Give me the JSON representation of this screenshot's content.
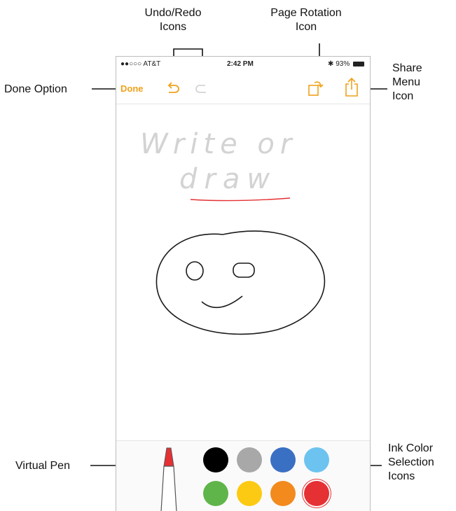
{
  "callouts": {
    "undo_redo": "Undo/Redo\nIcons",
    "page_rotation": "Page Rotation\nIcon",
    "done_option": "Done Option",
    "share_menu": "Share\nMenu\nIcon",
    "virtual_pen": "Virtual Pen",
    "ink_color": "Ink Color\nSelection\nIcons"
  },
  "status_bar": {
    "carrier": "●●○○○ AT&T",
    "time": "2:42 PM",
    "battery": "93%"
  },
  "toolbar": {
    "done_label": "Done",
    "accent_color": "#f0a11a",
    "icons": [
      "undo-icon",
      "redo-icon",
      "page-rotation-icon",
      "share-icon"
    ]
  },
  "canvas": {
    "handwriting_line1": "Write or",
    "handwriting_line2": "draw"
  },
  "ink_colors": [
    {
      "name": "black",
      "hex": "#000000"
    },
    {
      "name": "gray",
      "hex": "#a8a8a8"
    },
    {
      "name": "blue",
      "hex": "#3a70c3"
    },
    {
      "name": "light-blue",
      "hex": "#6cc3ef"
    },
    {
      "name": "green",
      "hex": "#5fb54a"
    },
    {
      "name": "yellow",
      "hex": "#fcca12"
    },
    {
      "name": "orange",
      "hex": "#f28a1e"
    },
    {
      "name": "red",
      "hex": "#e53034",
      "selected": true
    }
  ]
}
